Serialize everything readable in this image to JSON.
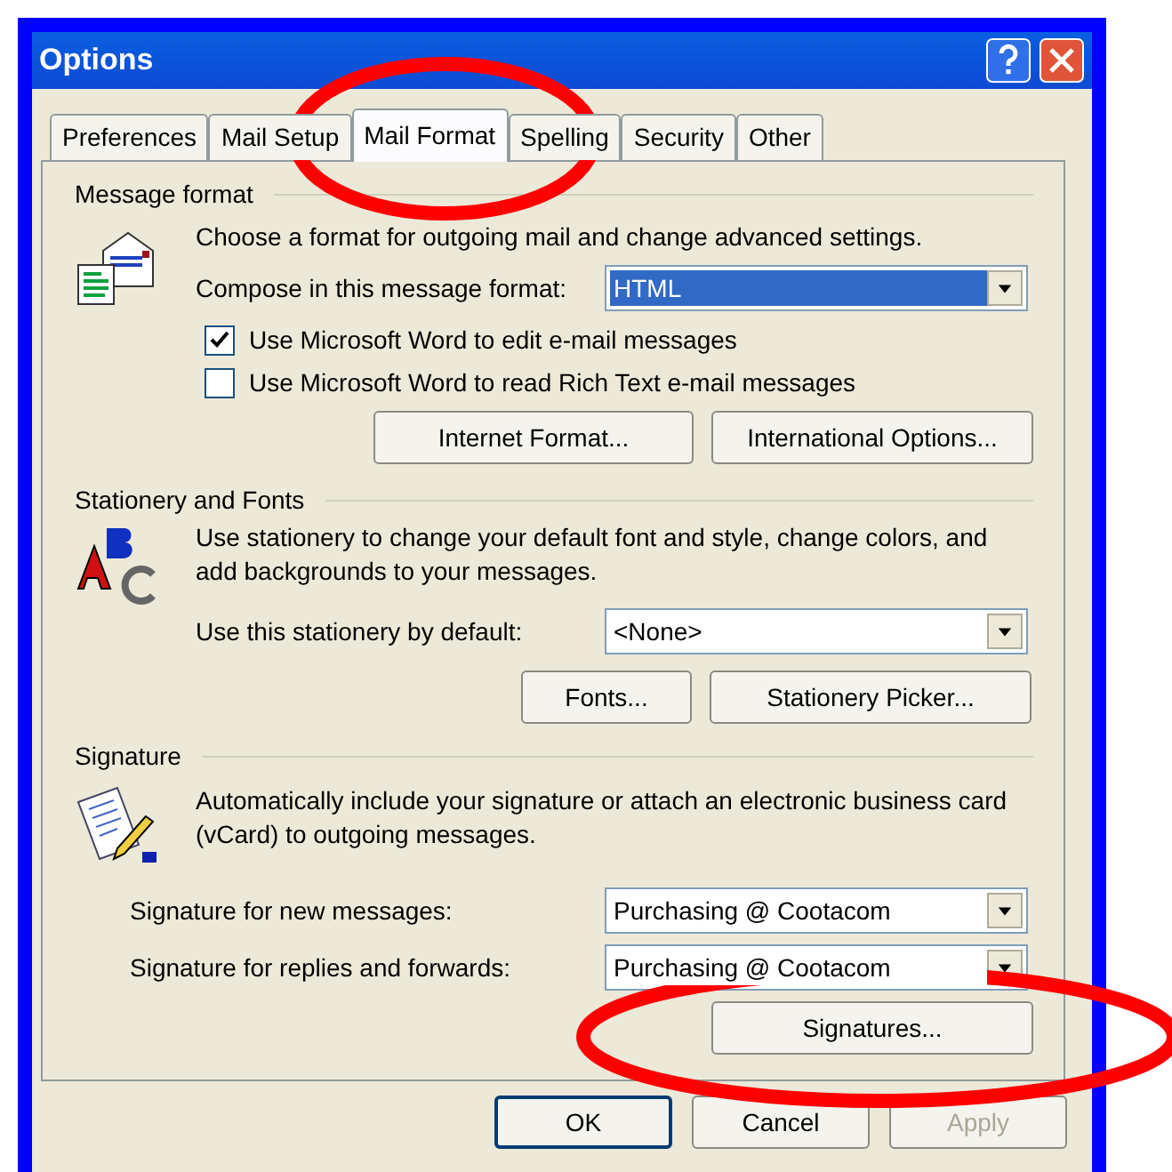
{
  "window": {
    "title": "Options"
  },
  "tabs": [
    {
      "label": "Preferences",
      "selected": false
    },
    {
      "label": "Mail Setup",
      "selected": false
    },
    {
      "label": "Mail Format",
      "selected": true
    },
    {
      "label": "Spelling",
      "selected": false
    },
    {
      "label": "Security",
      "selected": false
    },
    {
      "label": "Other",
      "selected": false
    }
  ],
  "message_format": {
    "heading": "Message format",
    "description": "Choose a format for outgoing mail and change advanced settings.",
    "compose_label": "Compose in this message format:",
    "compose_value": "HTML",
    "checkboxes": [
      {
        "label": "Use Microsoft Word to edit e-mail messages",
        "checked": true
      },
      {
        "label": "Use Microsoft Word to read Rich Text e-mail messages",
        "checked": false
      }
    ],
    "buttons": [
      "Internet Format...",
      "International Options..."
    ]
  },
  "stationery": {
    "heading": "Stationery and Fonts",
    "description": "Use stationery to change your default font and style, change colors, and add backgrounds to your messages.",
    "default_label": "Use this stationery by default:",
    "default_value": "<None>",
    "buttons": [
      "Fonts...",
      "Stationery Picker..."
    ]
  },
  "signature": {
    "heading": "Signature",
    "description": "Automatically include your signature or attach an electronic business card (vCard) to outgoing messages.",
    "fields": [
      {
        "label": "Signature for new messages:",
        "value": "Purchasing @ Cootacom"
      },
      {
        "label": "Signature for replies and forwards:",
        "value": "Purchasing @ Cootacom"
      }
    ],
    "buttons": [
      "Signatures..."
    ]
  },
  "footer_buttons": [
    {
      "label": "OK",
      "disabled": false
    },
    {
      "label": "Cancel",
      "disabled": false
    },
    {
      "label": "Apply",
      "disabled": true
    }
  ]
}
